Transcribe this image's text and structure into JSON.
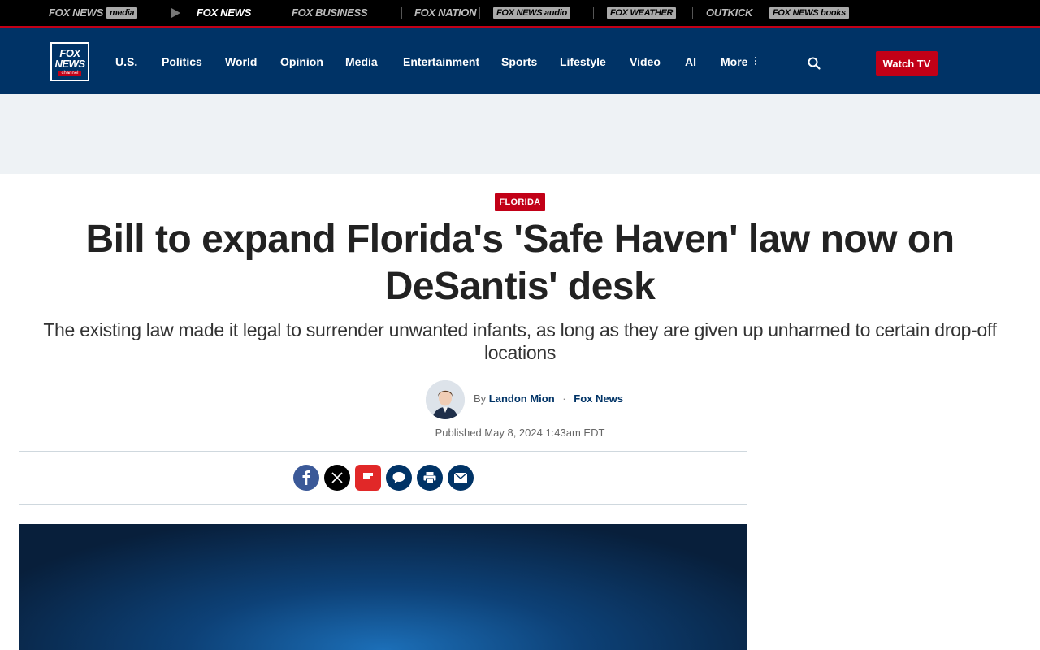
{
  "network_bar": {
    "items": [
      {
        "label": "FOX NEWS",
        "box": "media"
      },
      {
        "label": "FOX NEWS"
      },
      {
        "label": "FOX BUSINESS"
      },
      {
        "label": "FOX NATION"
      },
      {
        "label": "FOX NEWS",
        "box": "audio"
      },
      {
        "label": "FOX WEATHER"
      },
      {
        "label": "OUTKICK"
      },
      {
        "label": "FOX NEWS",
        "box": "books"
      }
    ]
  },
  "header": {
    "logo": {
      "line1": "FOX",
      "line2": "NEWS",
      "sub": "channel"
    },
    "nav": [
      "U.S.",
      "Politics",
      "World",
      "Opinion",
      "Media",
      "Entertainment",
      "Sports",
      "Lifestyle",
      "Video",
      "AI",
      "More"
    ],
    "watch_tv": "Watch TV"
  },
  "article": {
    "eyebrow": "FLORIDA",
    "headline": "Bill to expand Florida's 'Safe Haven' law now on DeSantis' desk",
    "subhead": "The existing law made it legal to surrender unwanted infants, as long as they are given up unharmed to certain drop-off locations",
    "byline_prefix": "By",
    "author": "Landon Mion",
    "outlet": "Fox News",
    "published": "Published May 8, 2024 1:43am EDT"
  },
  "share": {
    "buttons": [
      "facebook-icon",
      "x-icon",
      "flipboard-icon",
      "comments-icon",
      "print-icon",
      "email-icon"
    ]
  },
  "colors": {
    "brand_navy": "#003366",
    "brand_red": "#c20017",
    "facebook": "#3b5998",
    "flipboard": "#e12828"
  }
}
